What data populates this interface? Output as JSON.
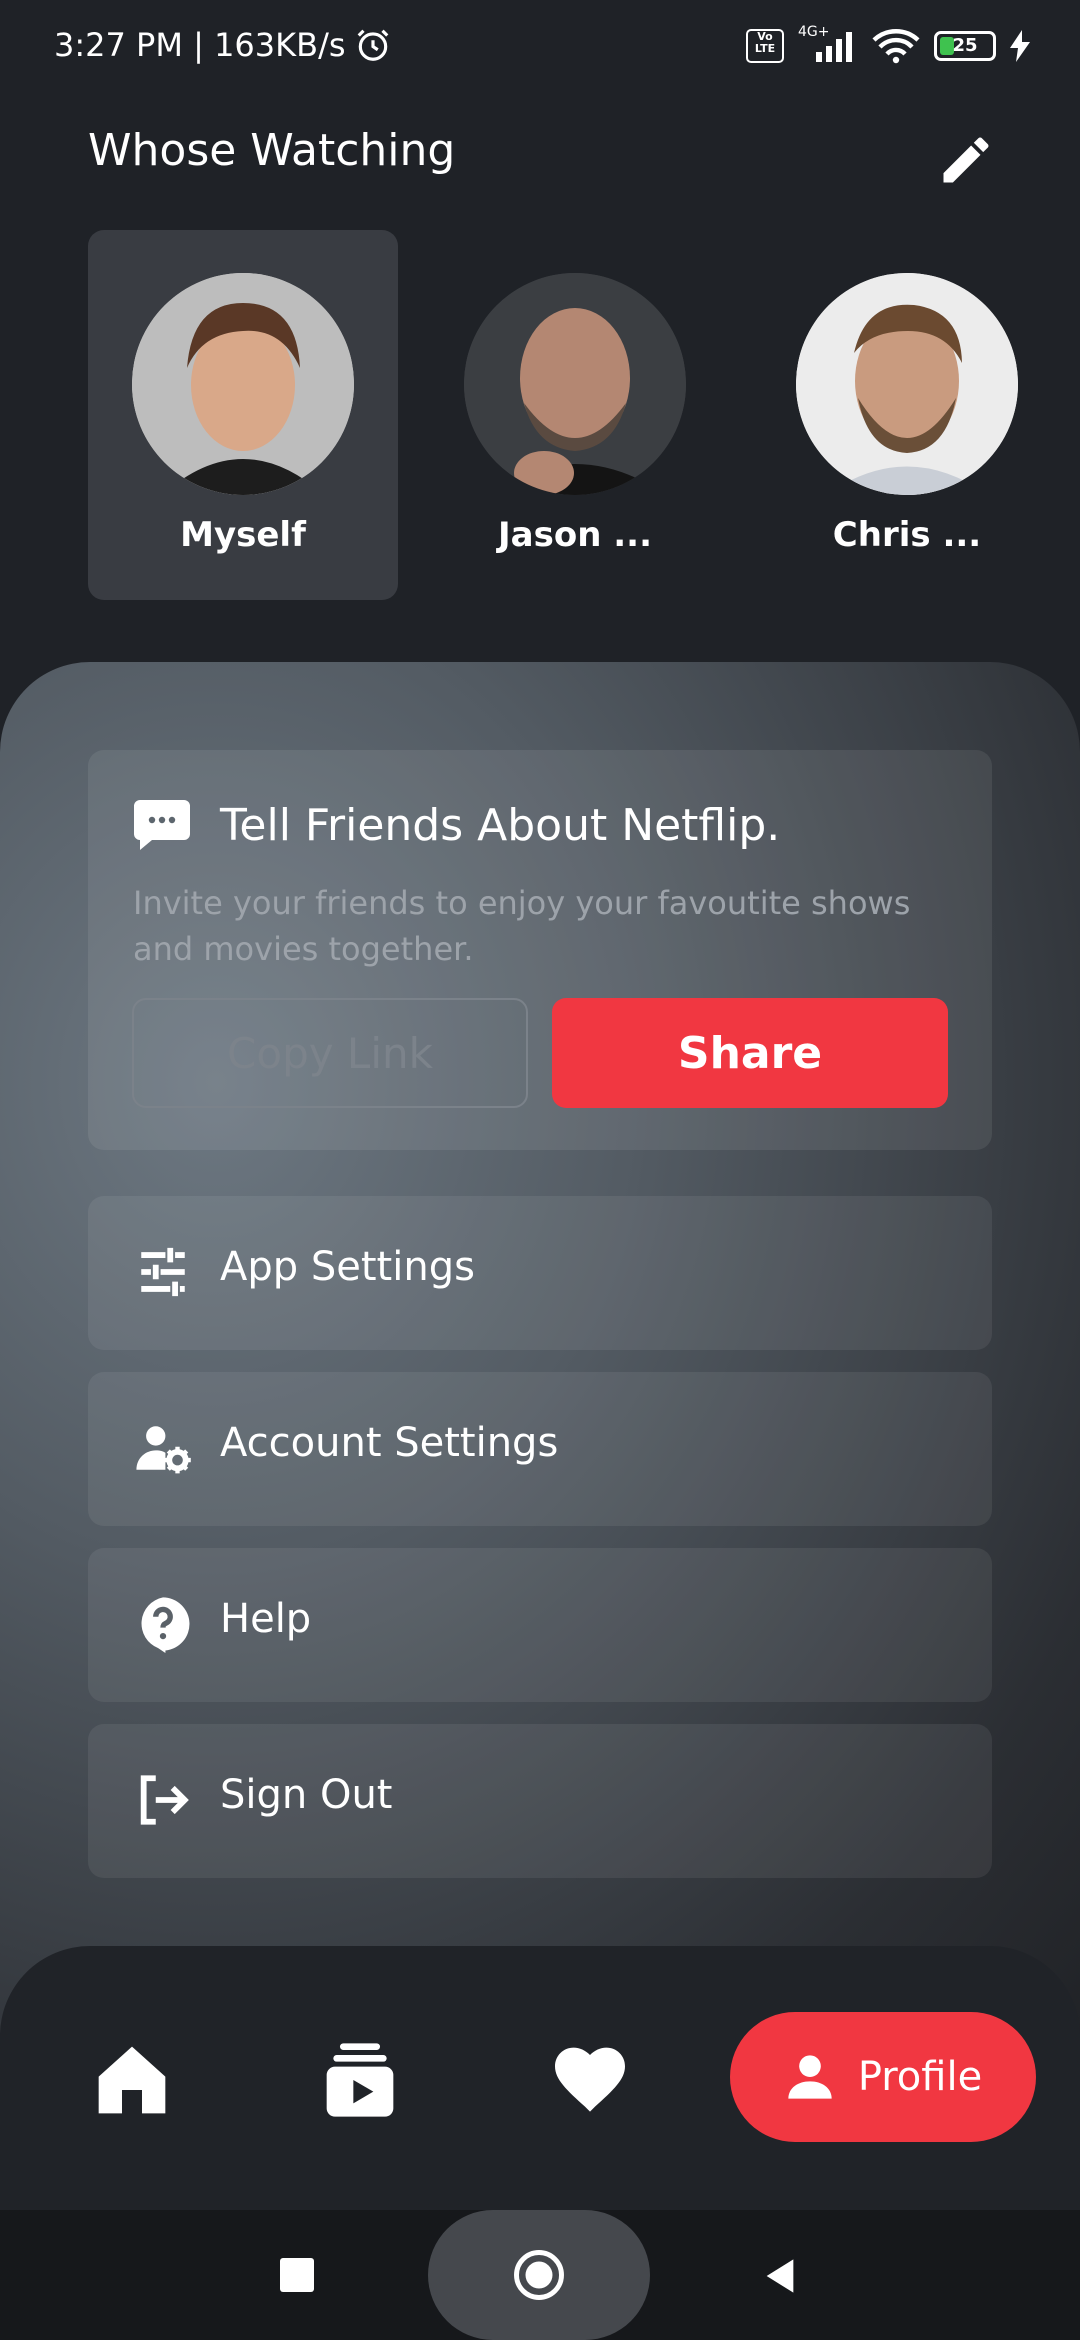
{
  "status_bar": {
    "time_speed": "3:27 PM | 163KB/s",
    "network": "4G+",
    "volte_top": "Vo",
    "volte_bottom": "LTE",
    "battery": "25"
  },
  "header": {
    "title": "Whose Watching"
  },
  "profiles": [
    {
      "name": "Myself",
      "selected": true
    },
    {
      "name": "Jason ...",
      "selected": false
    },
    {
      "name": "Chris ...",
      "selected": false
    }
  ],
  "invite": {
    "title": "Tell Friends About Netflip.",
    "description": "Invite your friends to enjoy your favoutite shows and movies together.",
    "copy_label": "Copy Link",
    "share_label": "Share"
  },
  "menu": [
    {
      "label": "App Settings",
      "icon": "sliders-icon"
    },
    {
      "label": "Account Settings",
      "icon": "user-gear-icon"
    },
    {
      "label": "Help",
      "icon": "help-icon"
    },
    {
      "label": "Sign Out",
      "icon": "sign-out-icon"
    }
  ],
  "bottom_nav": {
    "profile_label": "Profile",
    "icons": [
      "home-icon",
      "videos-icon",
      "heart-icon",
      "profile-icon"
    ]
  },
  "colors": {
    "accent": "#f13741",
    "background": "#1f2227"
  }
}
